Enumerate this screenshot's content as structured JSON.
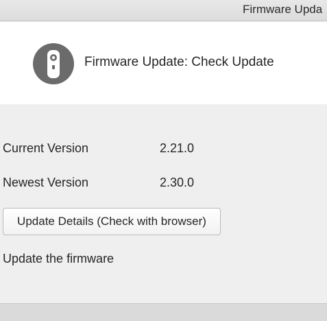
{
  "window": {
    "title": "Firmware Upda"
  },
  "header": {
    "icon": "camera-device-icon",
    "title": "Firmware Update:  Check Update"
  },
  "info": {
    "current_label": "Current Version",
    "current_value": "2.21.0",
    "newest_label": "Newest Version",
    "newest_value": "2.30.0"
  },
  "actions": {
    "details_button": "Update Details (Check with browser)",
    "update_link": "Update the firmware"
  }
}
